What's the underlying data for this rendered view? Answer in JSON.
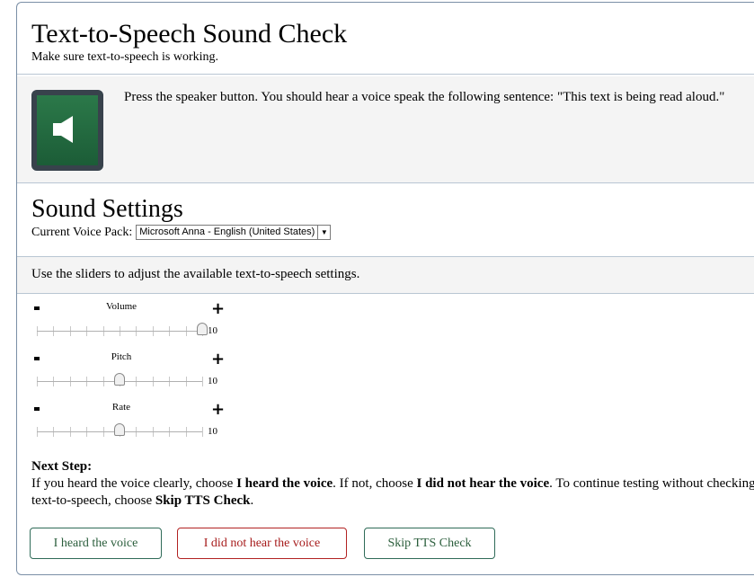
{
  "header": {
    "title": "Text-to-Speech Sound Check",
    "subtitle": "Make sure text-to-speech is working."
  },
  "speaker": {
    "icon": "speaker-icon",
    "instruction": "Press the speaker button. You should hear a voice speak the following sentence: \"This text is being read aloud.\""
  },
  "settings": {
    "title": "Sound Settings",
    "voice_label": "Current Voice Pack:",
    "voice_value": "Microsoft Anna - English (United States)",
    "instructions": "Use the sliders to adjust the available text-to-speech settings."
  },
  "sliders": [
    {
      "label": "Volume",
      "minus": "-",
      "plus": "+",
      "value": "10",
      "level": 1.0
    },
    {
      "label": "Pitch",
      "minus": "-",
      "plus": "+",
      "value": "10",
      "level": 0.5
    },
    {
      "label": "Rate",
      "minus": "-",
      "plus": "+",
      "value": "10",
      "level": 0.5
    }
  ],
  "next_step": {
    "heading": "Next Step:",
    "text_1": "If you heard the voice clearly, choose ",
    "strong_1": "I heard the voice",
    "text_2": ". If not, choose ",
    "strong_2": "I did not hear the voice",
    "text_3": ". To continue testing without checking text-to-speech, choose ",
    "strong_3": "Skip TTS Check",
    "text_4": "."
  },
  "buttons": {
    "heard": "I heard the voice",
    "not_heard": "I did not hear the voice",
    "skip": "Skip TTS Check"
  },
  "colors": {
    "speaker_green": "#1f6a3f",
    "border_blue": "#7a8fa6",
    "heard_border": "#2f6b58",
    "not_heard_border": "#b22222"
  }
}
